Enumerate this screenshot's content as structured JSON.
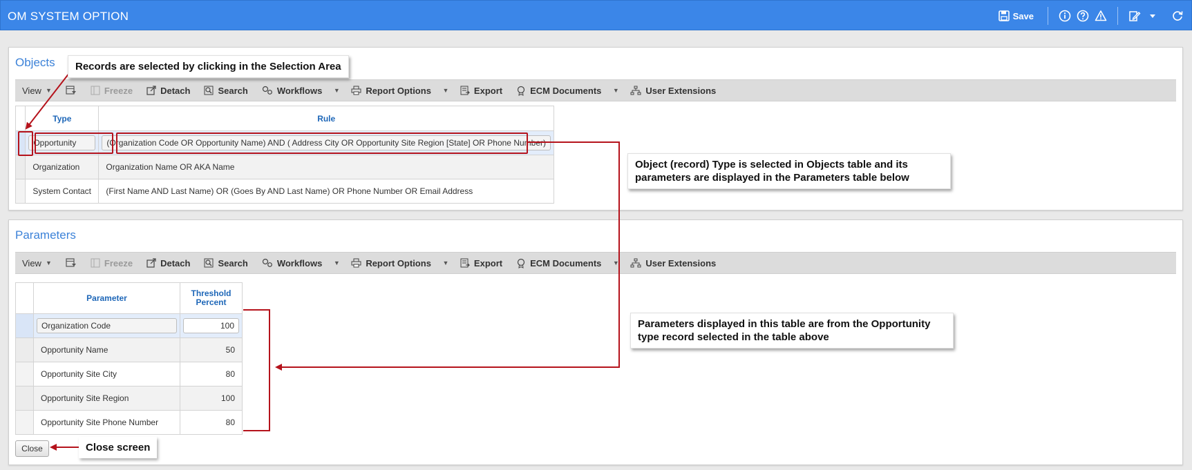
{
  "header": {
    "title": "OM SYSTEM OPTION",
    "save_label": "Save",
    "color": "#3b86e8"
  },
  "toolbar": {
    "view": "View",
    "freeze": "Freeze",
    "detach": "Detach",
    "search": "Search",
    "workflows": "Workflows",
    "report_options": "Report Options",
    "export": "Export",
    "ecm_documents": "ECM Documents",
    "user_extensions": "User Extensions"
  },
  "objects": {
    "title": "Objects",
    "columns": [
      "Type",
      "Rule"
    ],
    "rows": [
      {
        "type": "Opportunity",
        "rule": "(Organization Code OR Opportunity Name) AND ( Address City OR Opportunity Site Region [State] OR Phone Number)"
      },
      {
        "type": "Organization",
        "rule": "Organization Name OR AKA Name"
      },
      {
        "type": "System Contact",
        "rule": "(First Name AND Last Name) OR (Goes By AND Last Name) OR  Phone Number OR Email Address"
      }
    ]
  },
  "parameters": {
    "title": "Parameters",
    "col_parameter": "Parameter",
    "col_threshold_1": "Threshold",
    "col_threshold_2": "Percent",
    "rows": [
      {
        "name": "Organization Code",
        "value": "100"
      },
      {
        "name": "Opportunity Name",
        "value": "50"
      },
      {
        "name": "Opportunity Site City",
        "value": "80"
      },
      {
        "name": "Opportunity Site Region",
        "value": "100"
      },
      {
        "name": "Opportunity Site Phone Number",
        "value": "80"
      }
    ]
  },
  "close_label": "Close",
  "annotations": {
    "selection": "Records are selected by clicking in the Selection Area",
    "objects_1": "Object (record) Type is selected in Objects table and its",
    "objects_2": "parameters are displayed in the Parameters table below",
    "params_1": "Parameters displayed in this table are from the Opportunity",
    "params_2": "type record selected in the table above",
    "close": "Close screen"
  },
  "colors": {
    "accent": "#3c82d8",
    "annotation_red": "#b5121b"
  }
}
